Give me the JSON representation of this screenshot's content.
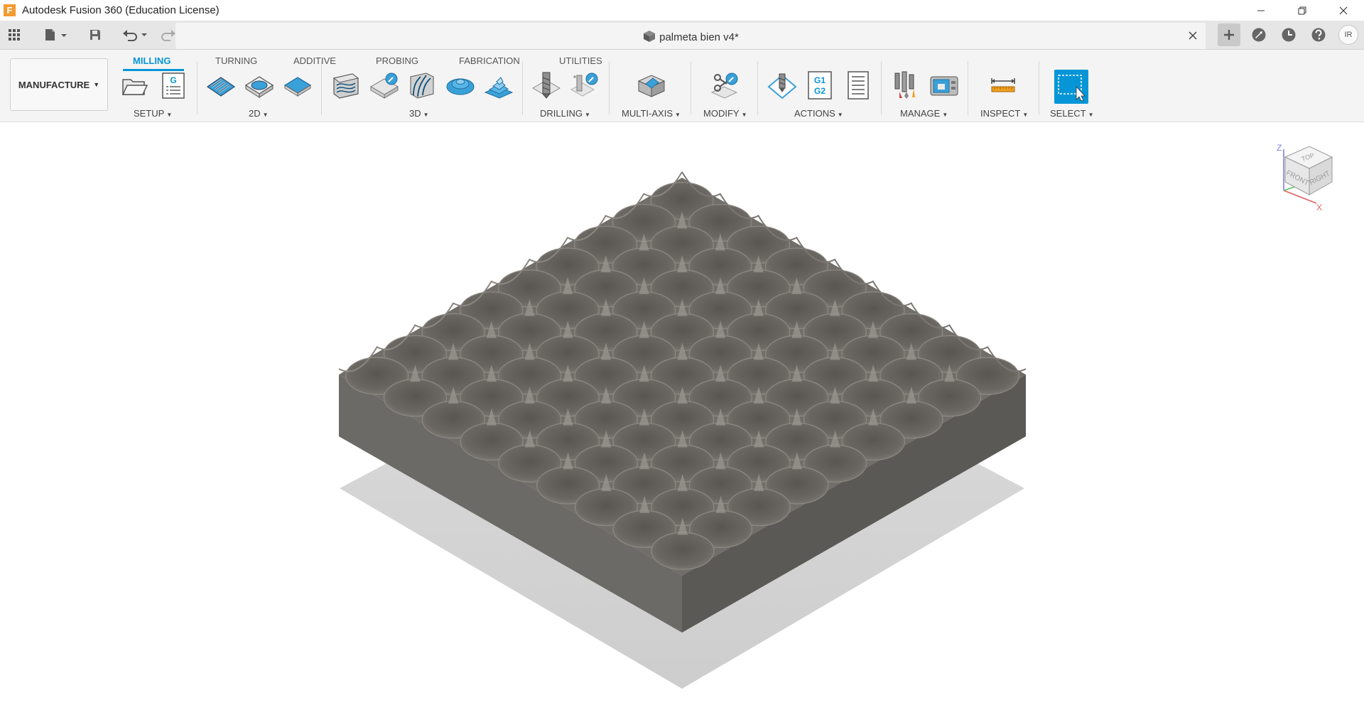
{
  "app": {
    "title": "Autodesk Fusion 360 (Education License)",
    "logo": "F"
  },
  "document": {
    "title": "palmeta bien v4*"
  },
  "user": {
    "initials": "IR"
  },
  "workspace": {
    "label": "MANUFACTURE"
  },
  "tabs": [
    {
      "label": "MILLING",
      "active": true
    },
    {
      "label": "TURNING",
      "active": false
    },
    {
      "label": "ADDITIVE",
      "active": false
    },
    {
      "label": "PROBING",
      "active": false
    },
    {
      "label": "FABRICATION",
      "active": false
    },
    {
      "label": "UTILITIES",
      "active": false
    }
  ],
  "groups": [
    {
      "label": "SETUP"
    },
    {
      "label": "2D"
    },
    {
      "label": "3D"
    },
    {
      "label": "DRILLING"
    },
    {
      "label": "MULTI-AXIS"
    },
    {
      "label": "MODIFY"
    },
    {
      "label": "ACTIONS"
    },
    {
      "label": "MANAGE"
    },
    {
      "label": "INSPECT"
    },
    {
      "label": "SELECT"
    }
  ],
  "actions": {
    "post_label_top": "G1",
    "post_label_bottom": "G2",
    "nc_label": "G"
  },
  "viewcube": {
    "top": "TOP",
    "front": "FRONT",
    "right": "RIGHT",
    "axis_z": "Z",
    "axis_x": "X"
  },
  "colors": {
    "accent": "#0696d7",
    "model_top": "#6e6b66",
    "model_side_left": "#6a6965",
    "model_side_right": "#5a5854",
    "shadow": "#d2d2d2"
  }
}
